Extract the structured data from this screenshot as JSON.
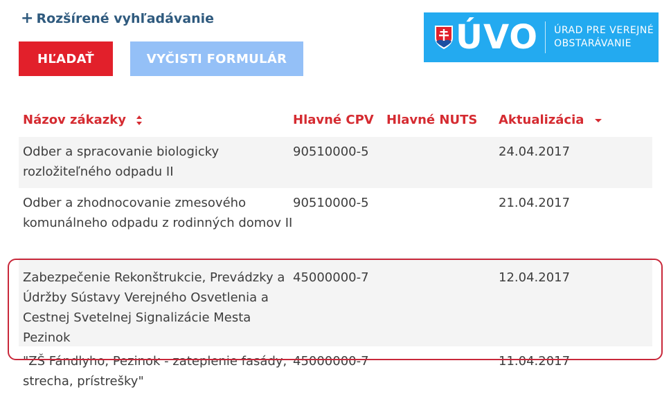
{
  "search": {
    "advanced_label": "Rozšírené vyhľadávanie",
    "search_button": "HĽADAŤ",
    "clear_button": "VYČISTI FORMULÁR"
  },
  "logo": {
    "brand": "ÚVO",
    "line1": "ÚRAD PRE VEREJNÉ",
    "line2": "OBSTARÁVANIE",
    "color": "#23aaf0"
  },
  "table": {
    "headers": {
      "name": "Názov zákazky",
      "cpv": "Hlavné CPV",
      "nuts": "Hlavné NUTS",
      "date": "Aktualizácia"
    },
    "rows": [
      {
        "name": "Odber a spracovanie biologicky rozložiteľného odpadu II",
        "cpv": "90510000-5",
        "nuts": "",
        "date": "24.04.2017"
      },
      {
        "name": "Odber a zhodnocovanie zmesového komunálneho odpadu z rodinných domov II",
        "cpv": "90510000-5",
        "nuts": "",
        "date": "21.04.2017"
      },
      {
        "name": "Zabezpečenie Rekonštrukcie, Prevádzky a Údržby Sústavy Verejného Osvetlenia a Cestnej Svetelnej Signalizácie Mesta Pezinok",
        "cpv": "45000000-7",
        "nuts": "",
        "date": "12.04.2017"
      },
      {
        "name": "\"ZŠ Fándlyho, Pezinok - zateplenie fasády, strecha, prístrešky\"",
        "cpv": "45000000-7",
        "nuts": "",
        "date": "11.04.2017"
      }
    ]
  },
  "colors": {
    "header_text": "#d52b31",
    "search_button": "#e2202b",
    "clear_button": "#94c0f7",
    "link": "#2f5a7e",
    "highlight_border": "#c8283a"
  }
}
